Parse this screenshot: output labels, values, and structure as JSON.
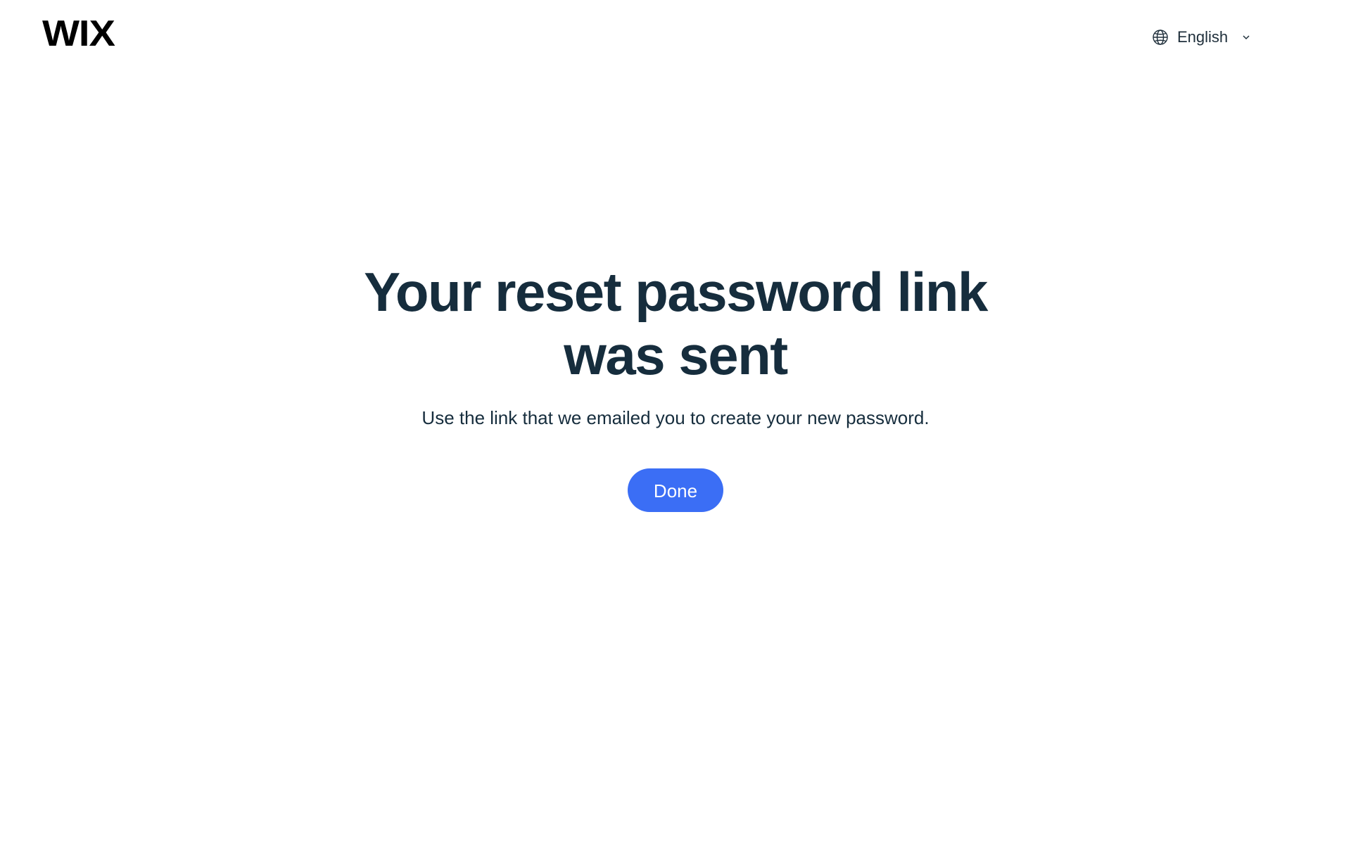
{
  "header": {
    "logo_text": "WIX",
    "language": {
      "label": "English",
      "icon": "globe-icon",
      "dropdown_icon": "chevron-down-icon"
    }
  },
  "main": {
    "title": "Your reset password link was sent",
    "subtitle": "Use the link that we emailed you to create your new password.",
    "done_label": "Done"
  },
  "colors": {
    "primary_button": "#3b6ef5",
    "heading_text": "#162d3d",
    "background": "#ffffff"
  }
}
